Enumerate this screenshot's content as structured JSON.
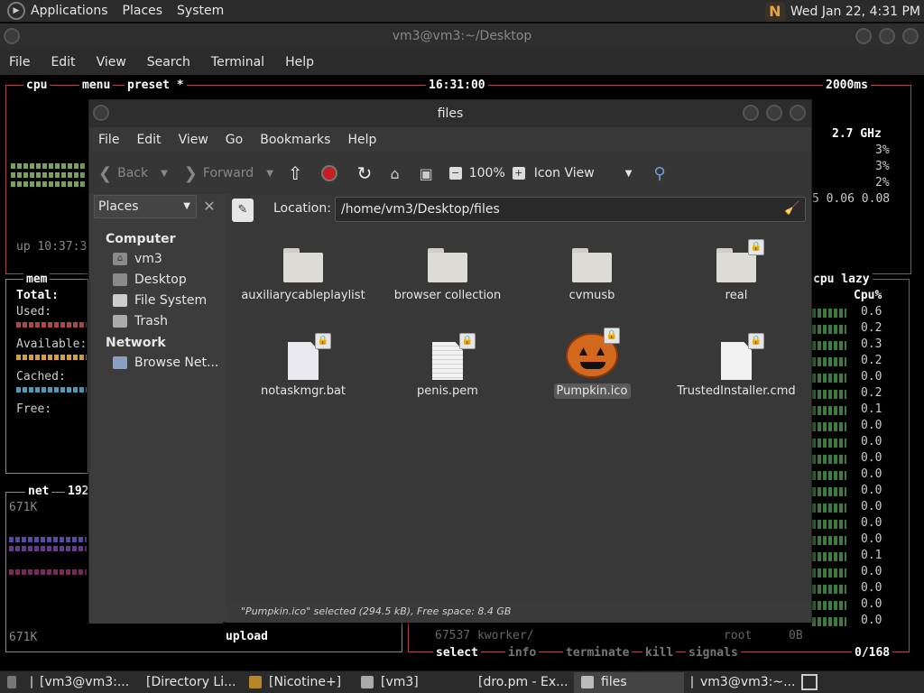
{
  "top_panel": {
    "menus": [
      "Applications",
      "Places",
      "System"
    ],
    "tray_icon": "nicotine-tray-icon",
    "datetime": "Wed Jan 22, 4:31 PM"
  },
  "terminal": {
    "title": "vm3@vm3:~/Desktop",
    "menu": [
      "File",
      "Edit",
      "View",
      "Search",
      "Terminal",
      "Help"
    ],
    "btop": {
      "tabs": {
        "cpu": "cpu",
        "menu": "menu",
        "preset": "preset *"
      },
      "time": "16:31:00",
      "refresh": "2000ms",
      "uptime": "up 10:37:3",
      "cpu_freq": "2.7 GHz",
      "cpu_pcts": [
        "3%",
        "3%",
        "2%"
      ],
      "load": "5 0.06 0.08",
      "mem_title": "mem",
      "mem_rows": [
        "Total:",
        "Used:",
        "Available:",
        "Cached:",
        "Free:"
      ],
      "net_title": "net",
      "net_addr": "192",
      "net_top": "671K",
      "net_bottom": "671K",
      "upload_label": "upload",
      "proc_header": "cpu lazy",
      "proc_col": "Cpu%",
      "proc_vals": [
        "0.6",
        "0.2",
        "0.3",
        "0.2",
        "0.0",
        "0.2",
        "0.1",
        "0.0",
        "0.0",
        "0.0",
        "0.0",
        "0.0",
        "0.0",
        "0.0",
        "0.0",
        "0.1",
        "0.0",
        "0.0",
        "0.0",
        "0.0"
      ],
      "proc_row": "67537 kworker/",
      "proc_user": "root",
      "proc_mem": "0B",
      "bottom_cmds": [
        "select",
        "info",
        "terminate",
        "kill",
        "signals"
      ],
      "proc_count": "0/168"
    }
  },
  "file_manager": {
    "title": "files",
    "menu": [
      "File",
      "Edit",
      "View",
      "Go",
      "Bookmarks",
      "Help"
    ],
    "toolbar": {
      "back": "Back",
      "forward": "Forward",
      "zoom": "100%",
      "view_mode": "Icon View"
    },
    "places_selector": "Places",
    "sidebar": {
      "computer_header": "Computer",
      "computer_items": [
        "vm3",
        "Desktop",
        "File System",
        "Trash"
      ],
      "network_header": "Network",
      "network_items": [
        "Browse Net..."
      ]
    },
    "location_label": "Location:",
    "location_path": "/home/vm3/Desktop/files",
    "files": [
      {
        "name": "auxiliarycableplaylist",
        "type": "folder",
        "locked": false
      },
      {
        "name": "browser collection",
        "type": "folder",
        "locked": false
      },
      {
        "name": "cvmusb",
        "type": "folder",
        "locked": false
      },
      {
        "name": "real",
        "type": "folder",
        "locked": true
      },
      {
        "name": "notaskmgr.bat",
        "type": "script",
        "locked": true
      },
      {
        "name": "penis.pem",
        "type": "text",
        "locked": true
      },
      {
        "name": "Pumpkin.ico",
        "type": "image",
        "locked": true,
        "selected": true
      },
      {
        "name": "TrustedInstaller.cmd",
        "type": "document",
        "locked": true
      }
    ],
    "status": "\"Pumpkin.ico\" selected (294.5 kB), Free space: 8.4 GB"
  },
  "taskbar": {
    "tasks": [
      {
        "label": "[vm3@vm3:...",
        "icon": "terminal-icon"
      },
      {
        "label": "[Directory Li...",
        "icon": "firefox-icon"
      },
      {
        "label": "[Nicotine+]",
        "icon": "nicotine-icon"
      },
      {
        "label": "[vm3]",
        "icon": "folder-icon"
      },
      {
        "label": "[dro.pm - Ex...",
        "icon": "firefox-icon"
      },
      {
        "label": "files",
        "icon": "folder-icon",
        "active": true
      },
      {
        "label": "vm3@vm3:~...",
        "icon": "terminal-icon"
      }
    ]
  }
}
